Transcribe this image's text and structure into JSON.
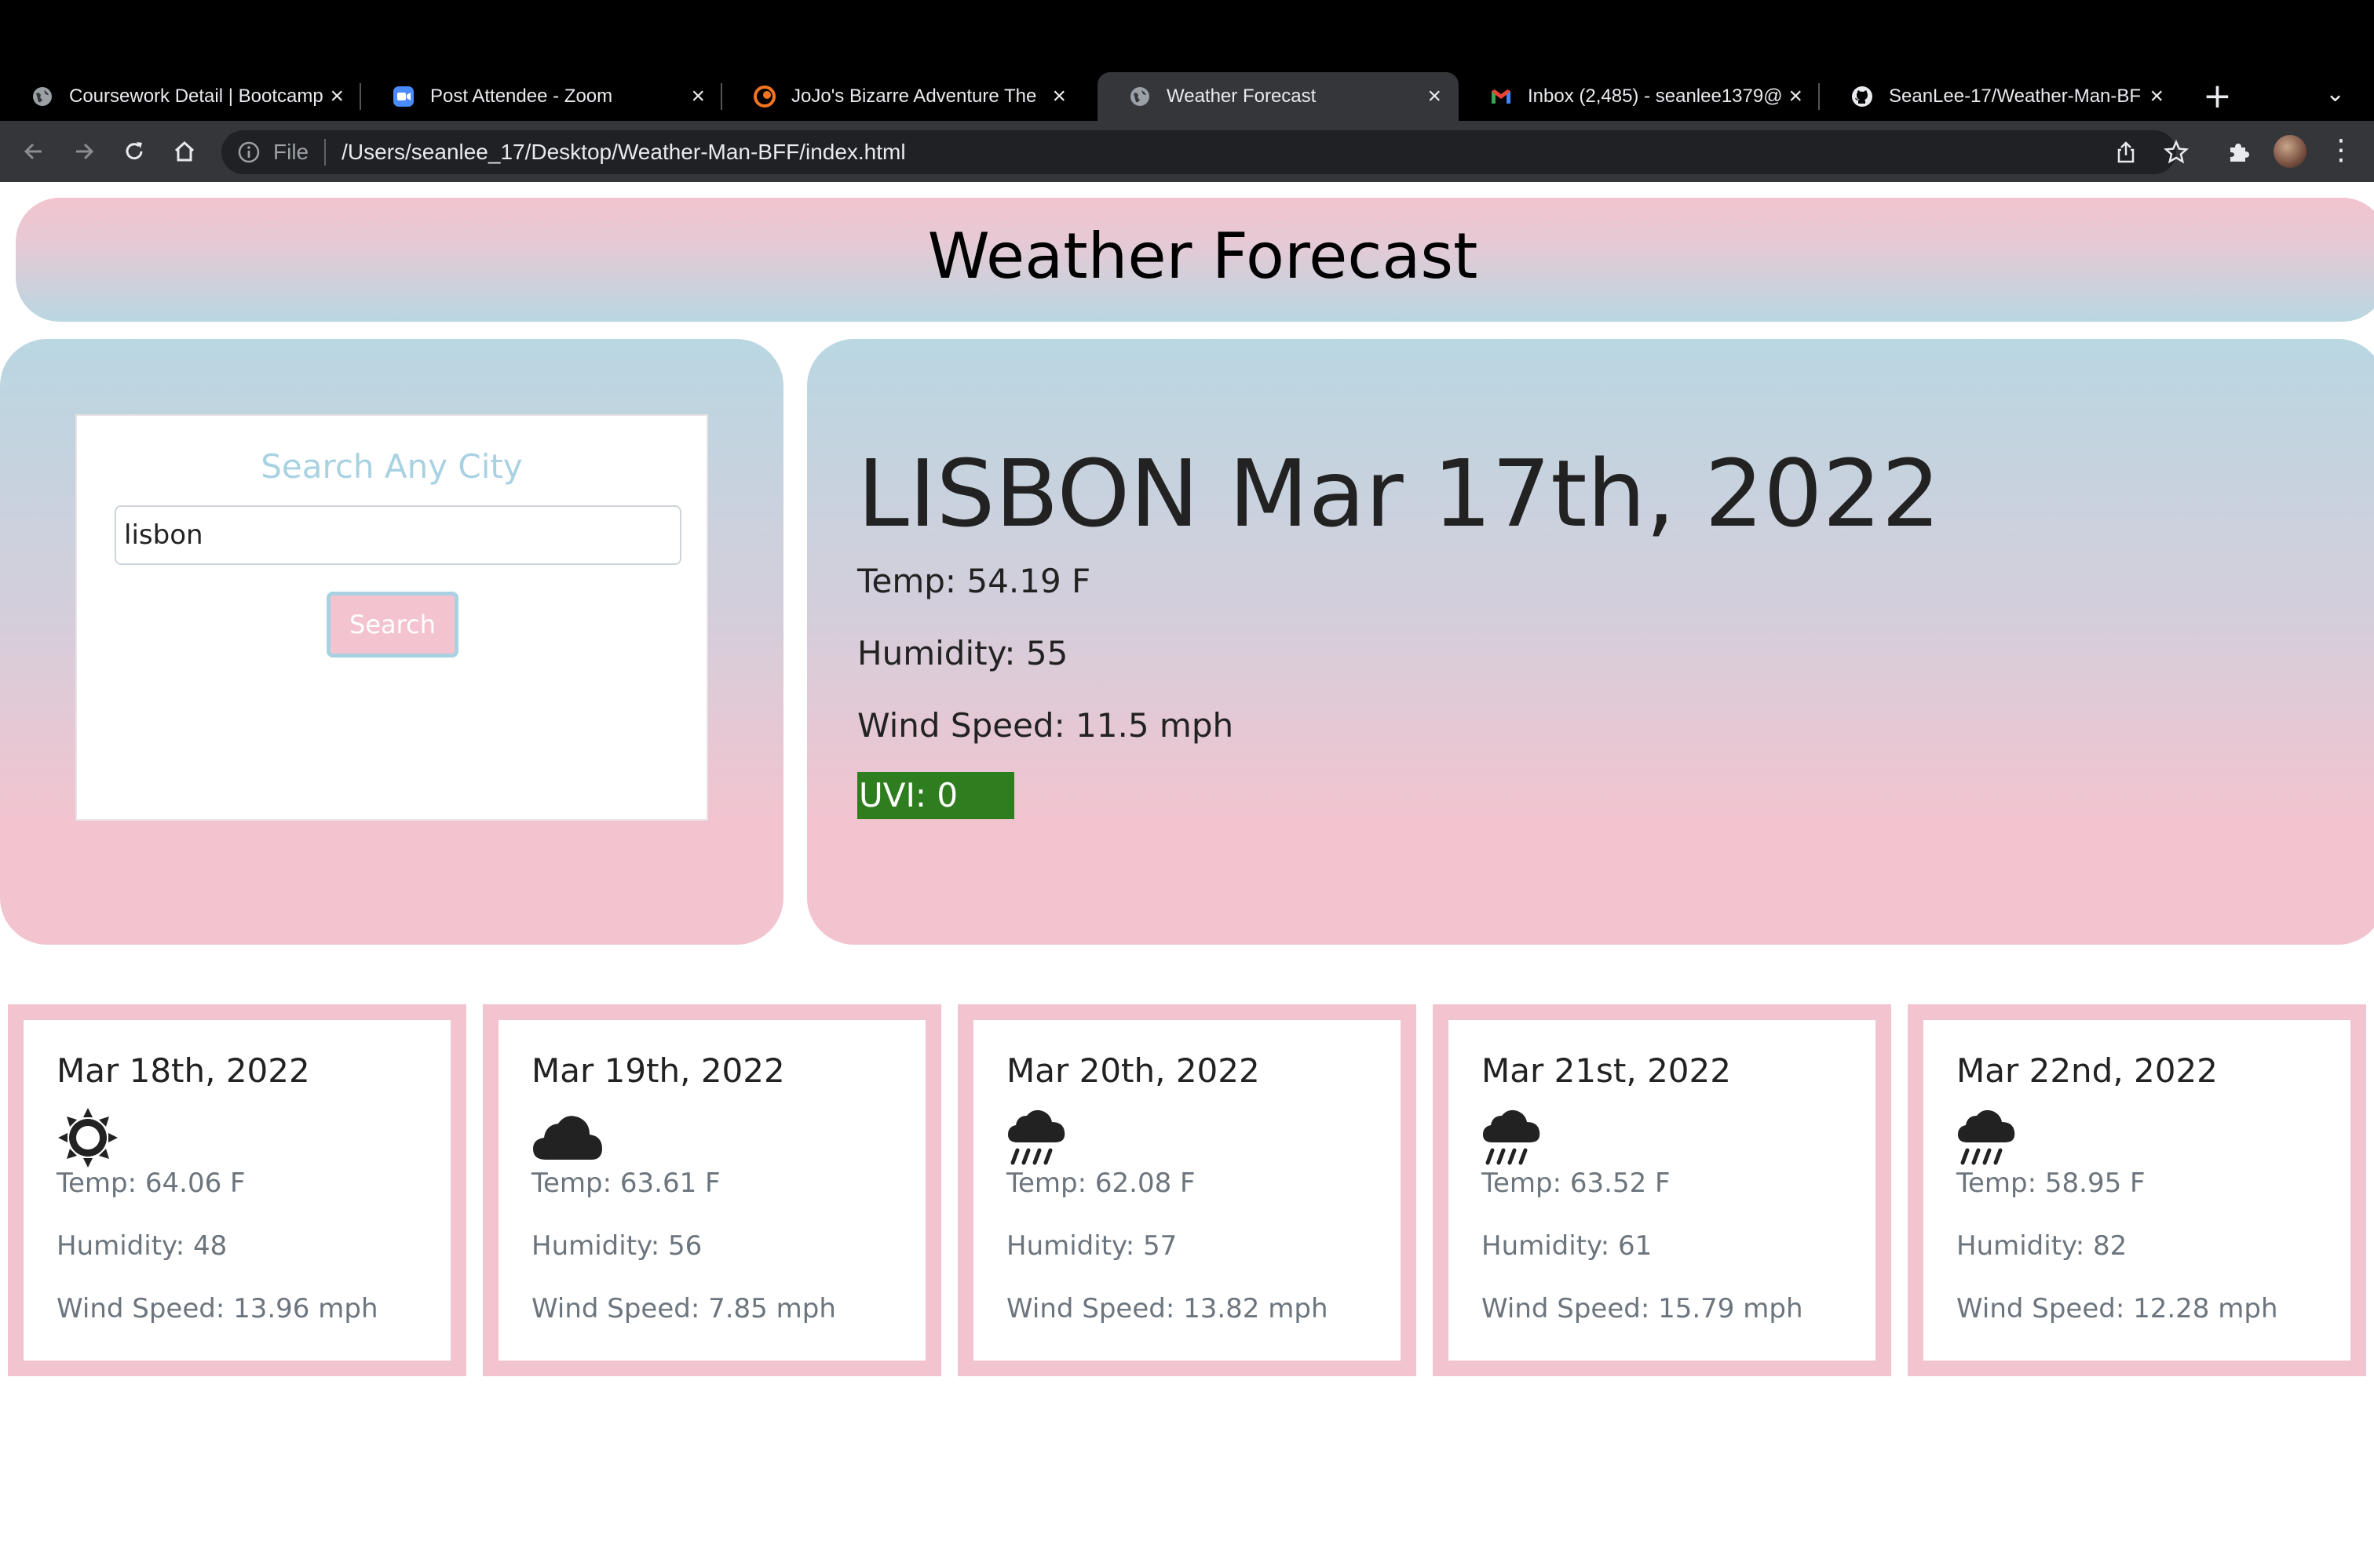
{
  "browser": {
    "tabs": [
      {
        "title": "Coursework Detail | Bootcamp",
        "favicon": "globe-icon"
      },
      {
        "title": "Post Attendee - Zoom",
        "favicon": "zoom-icon"
      },
      {
        "title": "JoJo's Bizarre Adventure The",
        "favicon": "crunchyroll-icon"
      },
      {
        "title": "Weather Forecast",
        "favicon": "globe-icon",
        "active": true
      },
      {
        "title": "Inbox (2,485) - seanlee1379@",
        "favicon": "gmail-icon"
      },
      {
        "title": "SeanLee-17/Weather-Man-BF",
        "favicon": "github-icon"
      }
    ],
    "address": {
      "scheme_label": "File",
      "url": "/Users/seanlee_17/Desktop/Weather-Man-BFF/index.html"
    }
  },
  "header": {
    "title": "Weather Forecast"
  },
  "search": {
    "title": "Search Any City",
    "input_value": "lisbon",
    "button_label": "Search"
  },
  "current": {
    "city_date": "LISBON Mar 17th, 2022",
    "temp": "Temp: 54.19 F",
    "humidity": "Humidity: 55",
    "wind": "Wind Speed: 11.5 mph",
    "uvi": "UVI: 0",
    "uvi_color": "#2e7d1e"
  },
  "forecast": [
    {
      "date": "Mar 18th, 2022",
      "icon": "sun-icon",
      "temp": "Temp: 64.06 F",
      "humidity": "Humidity: 48",
      "wind": "Wind Speed: 13.96 mph"
    },
    {
      "date": "Mar 19th, 2022",
      "icon": "cloud-icon",
      "temp": "Temp: 63.61 F",
      "humidity": "Humidity: 56",
      "wind": "Wind Speed: 7.85 mph"
    },
    {
      "date": "Mar 20th, 2022",
      "icon": "cloud-rain-icon",
      "temp": "Temp: 62.08 F",
      "humidity": "Humidity: 57",
      "wind": "Wind Speed: 13.82 mph"
    },
    {
      "date": "Mar 21st, 2022",
      "icon": "cloud-rain-icon",
      "temp": "Temp: 63.52 F",
      "humidity": "Humidity: 61",
      "wind": "Wind Speed: 15.79 mph"
    },
    {
      "date": "Mar 22nd, 2022",
      "icon": "cloud-rain-icon",
      "temp": "Temp: 58.95 F",
      "humidity": "Humidity: 82",
      "wind": "Wind Speed: 12.28 mph"
    }
  ],
  "colors": {
    "pink": "#f2c4cf",
    "blue": "#b9d7e2",
    "uvi_low": "#2e7d1e"
  }
}
